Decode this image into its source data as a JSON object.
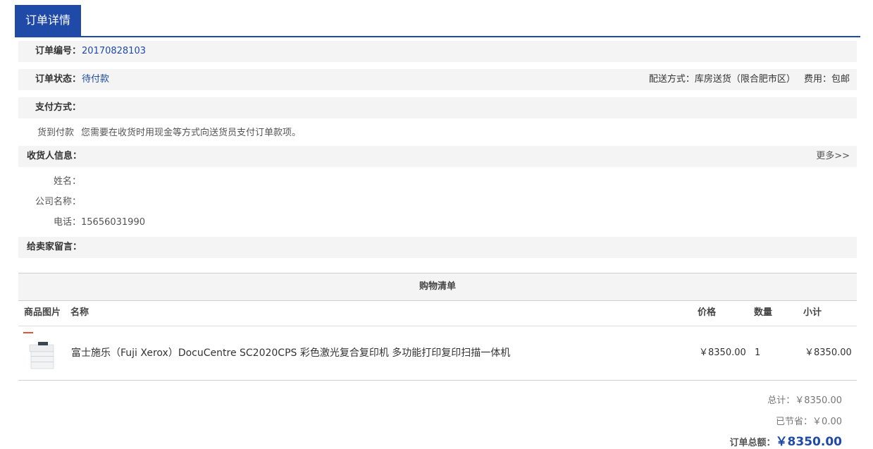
{
  "tab": {
    "label": "订单详情"
  },
  "order": {
    "number_label": "订单编号：",
    "number_value": "20170828103",
    "status_label": "订单状态：",
    "status_value": "待付款",
    "delivery": "配送方式：库房送货（限合肥市区）",
    "fee": "费用：包邮",
    "payment_label": "支付方式：",
    "payment_method": "货到付款",
    "payment_desc": "您需要在收货时用现金等方式向送货员支付订单款项。"
  },
  "receiver": {
    "section_label": "收货人信息：",
    "more": "更多>>",
    "name_label": "姓名：",
    "name_value": "",
    "company_label": "公司名称：",
    "company_value": "",
    "phone_label": "电话：",
    "phone_value": "15656031990"
  },
  "message": {
    "label": "给卖家留言："
  },
  "cart": {
    "title": "购物清单",
    "headers": {
      "image": "商品图片",
      "name": "名称",
      "price": "价格",
      "qty": "数量",
      "subtotal": "小计"
    },
    "items": [
      {
        "name": "富士施乐（Fuji Xerox）DocuCentre SC2020CPS 彩色激光复合复印机 多功能打印复印扫描一体机",
        "price": "￥8350.00",
        "qty": "1",
        "subtotal": "￥8350.00"
      }
    ]
  },
  "summary": {
    "total_label": "总计：",
    "total_value": "￥8350.00",
    "saved_label": "已节省：",
    "saved_value": "￥0.00",
    "order_total_label": "订单总额：",
    "order_total_value": "￥8350.00"
  },
  "colors": {
    "accent": "#1f4aa8",
    "row_bg": "#f4f4f4"
  },
  "icons": {
    "product": "printer-product-image"
  }
}
